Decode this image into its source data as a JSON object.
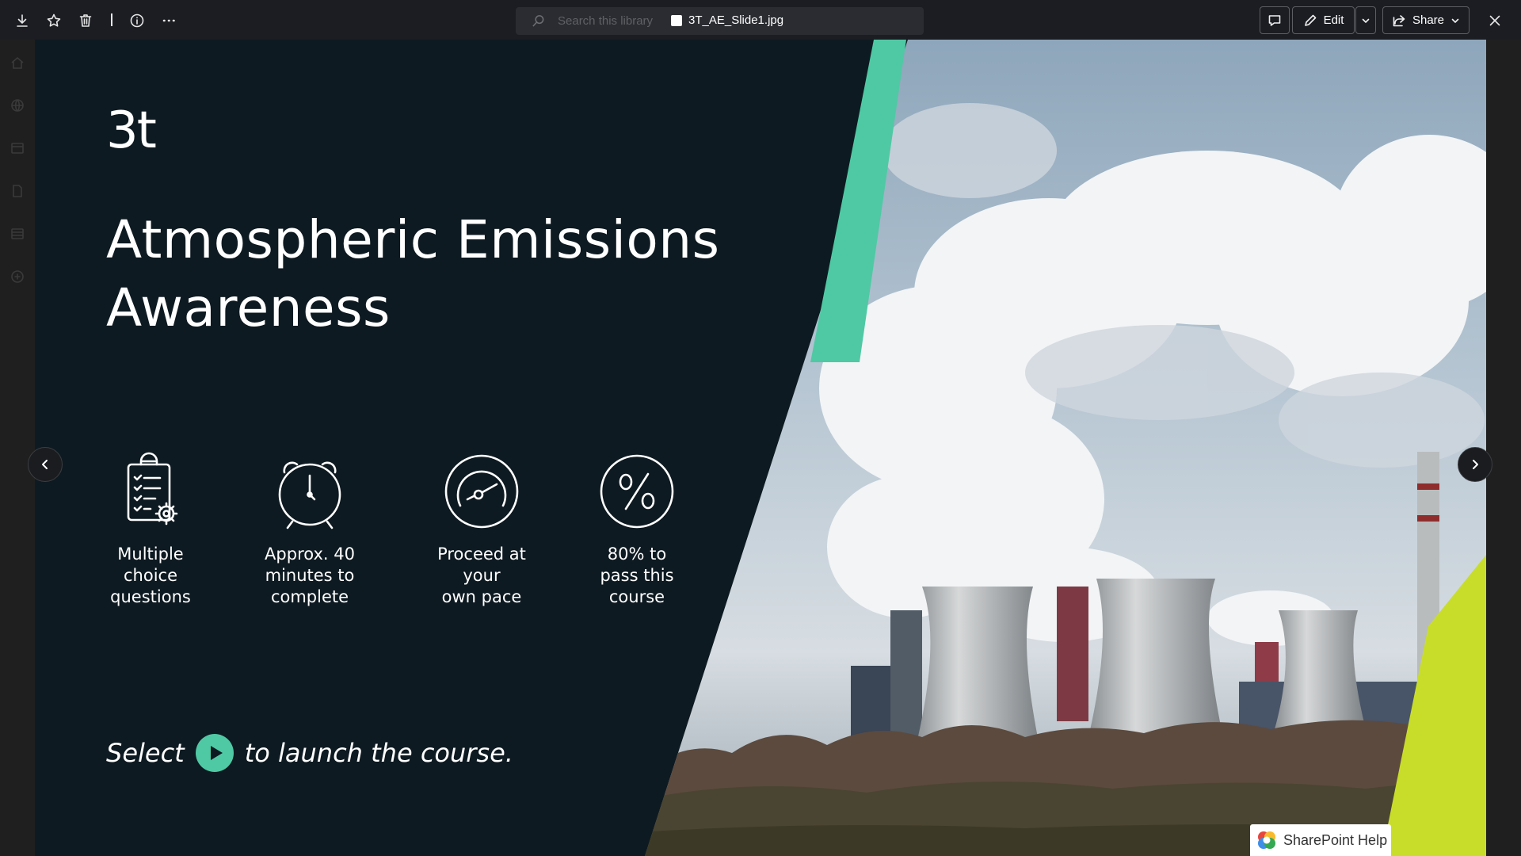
{
  "toolbar": {
    "search_placeholder": "Search this library",
    "file_name": "3T_AE_Slide1.jpg",
    "edit_label": "Edit",
    "share_label": "Share"
  },
  "slide": {
    "logo": "3t",
    "title_line1": "Atmospheric Emissions",
    "title_line2": "Awareness",
    "features": [
      {
        "label": "Multiple\nchoice\nquestions",
        "icon": "clipboard-checklist-icon"
      },
      {
        "label": "Approx. 40\nminutes to\ncomplete",
        "icon": "alarm-clock-icon"
      },
      {
        "label": "Proceed at\nyour\nown pace",
        "icon": "speedometer-icon"
      },
      {
        "label": "80% to\npass this\ncourse",
        "icon": "percent-icon"
      }
    ],
    "cta_before": "Select",
    "cta_after": "to launch the course.",
    "accent_teal": "#4fc9a4",
    "accent_lime": "#c8dd2a",
    "background": "#0e1a21"
  },
  "help": {
    "label": "SharePoint Help"
  }
}
